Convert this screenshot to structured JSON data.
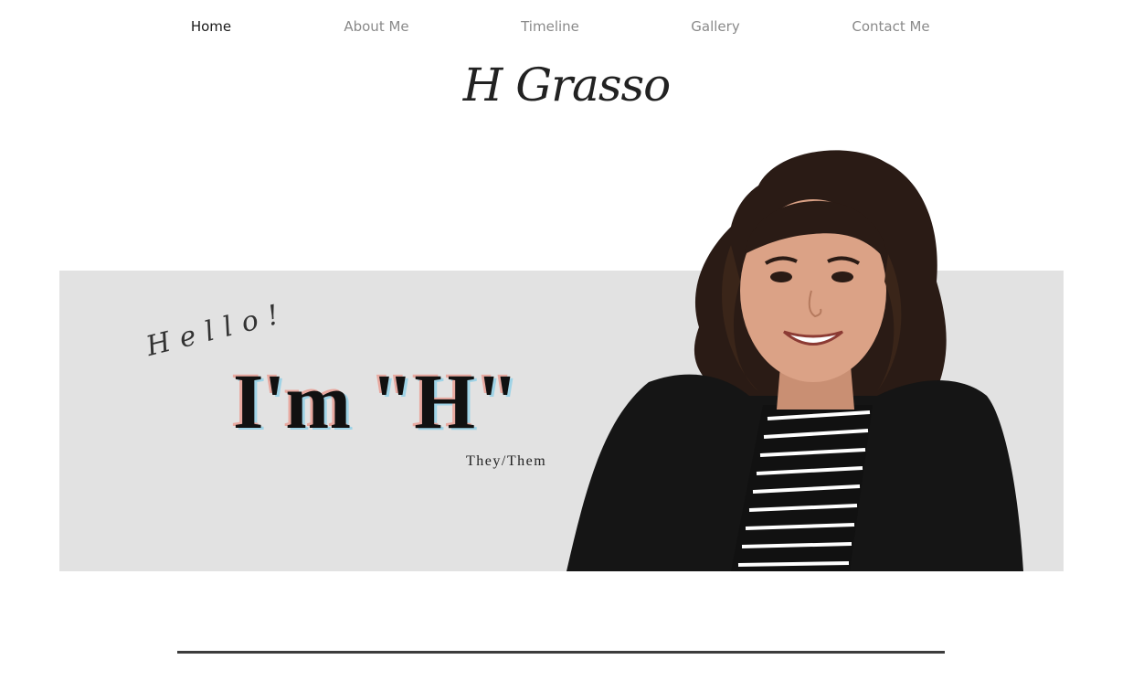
{
  "nav": {
    "items": [
      {
        "label": "Home",
        "active": true
      },
      {
        "label": "About Me",
        "active": false
      },
      {
        "label": "Timeline",
        "active": false
      },
      {
        "label": "Gallery",
        "active": false
      },
      {
        "label": "Contact Me",
        "active": false
      }
    ]
  },
  "logo": {
    "text": "H Grasso"
  },
  "hero": {
    "greeting": "Hello!",
    "headline": "I'm \"H\"",
    "pronouns": "They/Them"
  },
  "colors": {
    "hero_background": "#e2e2e2",
    "nav_active": "#1a1a1a",
    "nav_inactive": "#8a8a8a",
    "headline_shadow_pink": "#e8a9a0",
    "headline_shadow_blue": "#9fd3e6",
    "divider": "#3c3c3c"
  }
}
